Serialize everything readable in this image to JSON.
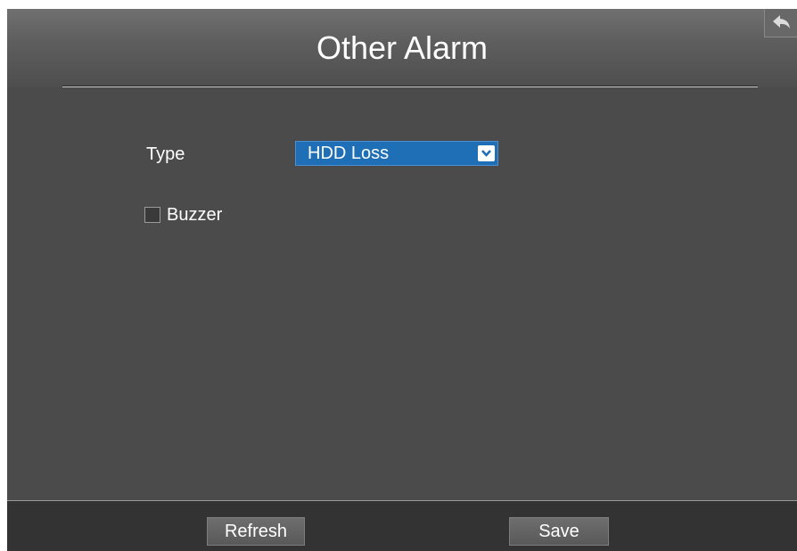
{
  "header": {
    "title": "Other Alarm",
    "back_icon": "back-arrow-icon"
  },
  "form": {
    "type_label": "Type",
    "type_value": "HDD Loss",
    "buzzer_label": "Buzzer",
    "buzzer_checked": false
  },
  "footer": {
    "refresh_label": "Refresh",
    "save_label": "Save"
  },
  "colors": {
    "background": "#4b4b4b",
    "footer": "#333333",
    "select_accent": "#1f6fb6",
    "text": "#ffffff"
  }
}
